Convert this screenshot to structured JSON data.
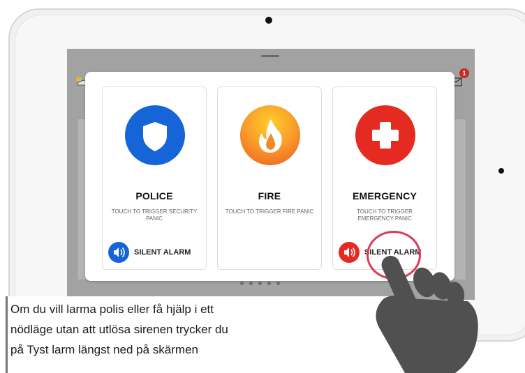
{
  "colors": {
    "police_blue": "#1565d8",
    "fire_orange": "#f05a22",
    "fire_yellow": "#ffcd2a",
    "emergency_red": "#e52a22",
    "highlight_ring": "#df3a55",
    "hand_gray": "#505050"
  },
  "status_bar": {
    "weather_icon": "sun-cloud-icon",
    "message_icon": "envelope-icon",
    "notification_count": "1"
  },
  "panic_dialog": {
    "cards": [
      {
        "icon": "shield-icon",
        "title": "POLICE",
        "description": "TOUCH TO TRIGGER SECURITY PANIC",
        "speaker_icon": "speaker-icon",
        "silent_label": "SILENT ALARM"
      },
      {
        "icon": "flame-icon",
        "title": "FIRE",
        "description": "TOUCH TO TRIGGER FIRE PANIC"
      },
      {
        "icon": "cross-icon",
        "title": "EMERGENCY",
        "description": "TOUCH TO TRIGGER EMERGENCY PANIC",
        "speaker_icon": "speaker-icon",
        "silent_label": "SILENT ALARM"
      }
    ]
  },
  "caption": {
    "lines": [
      "Om du vill larma polis eller få hjälp i ett",
      "nödläge utan att utlösa sirenen trycker du",
      "på Tyst larm längst ned på skärmen"
    ]
  }
}
